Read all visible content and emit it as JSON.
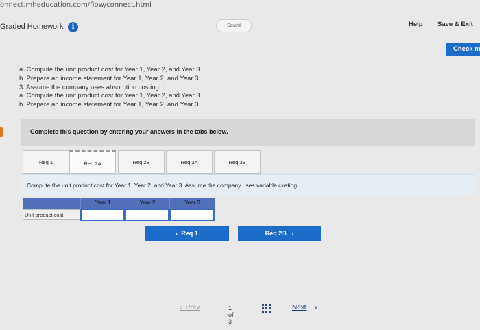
{
  "browser": {
    "url": "onnect.mheducation.com/flow/connect.html"
  },
  "header": {
    "title": "Graded Homework",
    "info_icon": "i",
    "saved_label": "Saved",
    "help_label": "Help",
    "save_exit_label": "Save & Exit",
    "check_label": "Check m"
  },
  "instructions": [
    "a. Compute the unit product cost for Year 1, Year 2, and Year 3.",
    "b. Prepare an income statement for Year 1, Year 2, and Year 3.",
    "3. Assume the company uses absorption costing:",
    "a. Compute the unit product cost for Year 1, Year 2, and Year 3.",
    "b. Prepare an income statement for Year 1, Year 2, and Year 3."
  ],
  "panel": {
    "text": "Complete this question by entering your answers in the tabs below."
  },
  "tabs": [
    {
      "label": "Req 1"
    },
    {
      "label": "Req 2A"
    },
    {
      "label": "Req 2B"
    },
    {
      "label": "Req 3A"
    },
    {
      "label": "Req 3B"
    }
  ],
  "active_tab": 1,
  "question": "Compute the unit product cost for Year 1, Year 2, and Year 3. Assume the company uses variable costing.",
  "table": {
    "columns": [
      "Year 1",
      "Year 2",
      "Year 3"
    ],
    "row_label": "Unit product cost",
    "values": [
      "",
      "",
      ""
    ]
  },
  "nav": {
    "prev_req_label": "Req 1",
    "next_req_label": "Req 2B"
  },
  "pager": {
    "prev_label": "Prev",
    "count_text": "1 of 3",
    "next_label": "Next"
  },
  "colors": {
    "accent": "#1e6cc9",
    "table_header": "#4f70b9",
    "info_icon": "#1f66c2"
  }
}
